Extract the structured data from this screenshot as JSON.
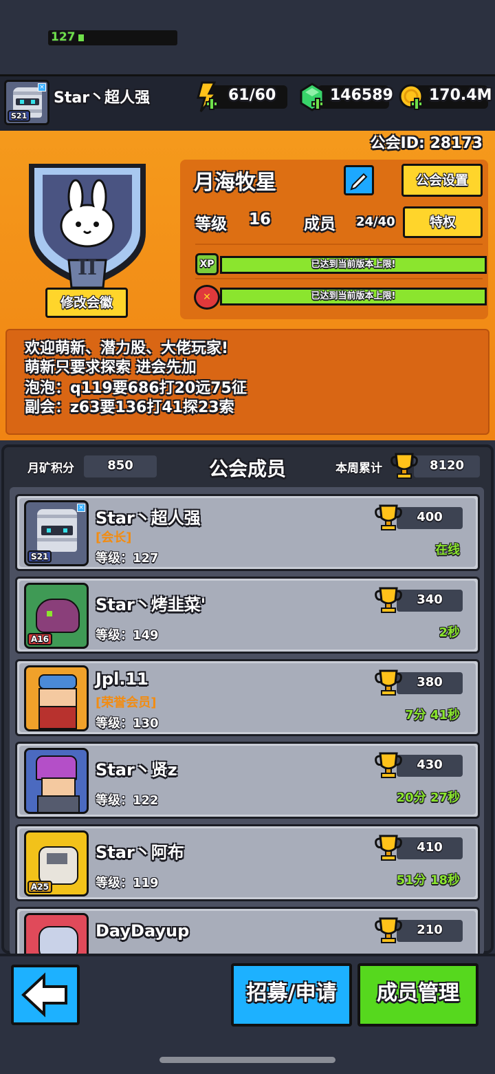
{
  "player": {
    "name": "Star丶超人强",
    "level": "127",
    "season_tag": "S21"
  },
  "resources": {
    "energy": "61/60",
    "gems": "146589",
    "coins": "170.4M"
  },
  "guild": {
    "id_text": "公会ID: 28173",
    "name": "月海牧星",
    "level_label": "等级",
    "level": "16",
    "members_label": "成员",
    "members": "24/40",
    "settings_button": "公会设置",
    "privilege_button": "特权",
    "change_badge_button": "修改会徽",
    "badge_rank": "II",
    "xp_icon_label": "XP",
    "xp_bar_text": "已达到当前版本上限!",
    "skill_bar_text": "已达到当前版本上限!",
    "notice": [
      "欢迎萌新、潜力股、大佬玩家!",
      "萌新只要求探索 进会先加",
      "泡泡：q119要686打20远75征",
      "副会：z63要136打41探23索"
    ]
  },
  "members_panel": {
    "title": "公会成员",
    "mine_label": "月矿积分",
    "mine_value": "850",
    "weekly_label": "本周累计",
    "weekly_value": "8120"
  },
  "members": [
    {
      "name": "Star丶超人强",
      "title": "[会长]",
      "level": "等级：127",
      "score": "400",
      "status": "在线",
      "tag": "S21"
    },
    {
      "name": "Star丶烤韭菜'",
      "title": "",
      "level": "等级：149",
      "score": "340",
      "status": "2秒",
      "tag": "A16"
    },
    {
      "name": "Jpl.11",
      "title": "[荣誉会员]",
      "level": "等级：130",
      "score": "380",
      "status": "7分 41秒",
      "tag": ""
    },
    {
      "name": "Star丶贤z",
      "title": "",
      "level": "等级：122",
      "score": "430",
      "status": "20分 27秒",
      "tag": ""
    },
    {
      "name": "Star丶阿布",
      "title": "",
      "level": "等级：119",
      "score": "410",
      "status": "51分 18秒",
      "tag": "A25"
    },
    {
      "name": "DayDayup",
      "title": "",
      "level": "",
      "score": "210",
      "status": "",
      "tag": ""
    }
  ],
  "bottom": {
    "recruit_button": "招募/申请",
    "manage_button": "成员管理"
  },
  "colors": {
    "guild_orange": "#f08413",
    "online_green": "#8be52e",
    "button_blue": "#1db1ff",
    "button_green": "#56d81e",
    "button_yellow": "#ffd52b"
  }
}
